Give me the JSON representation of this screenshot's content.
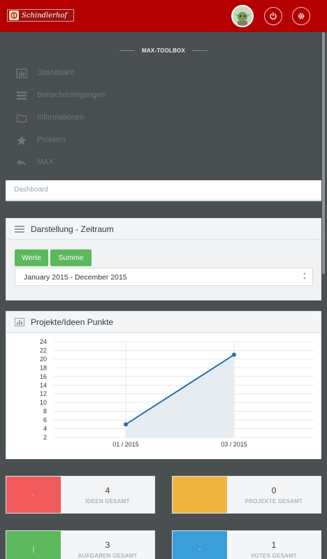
{
  "app": {
    "logo_text": "Schindlerhof",
    "avatar_alt": "user avatar",
    "icons": {
      "power": "power-icon",
      "settings": "gear-icon"
    }
  },
  "nav": {
    "title": "MAX-TOOLBOX",
    "items": [
      {
        "label": "Dashboard",
        "icon": "bar-chart-icon"
      },
      {
        "label": "Benachrichtigungen",
        "icon": "list-icon"
      },
      {
        "label": "Informationen",
        "icon": "folder-icon"
      },
      {
        "label": "Proidem",
        "icon": "star-icon"
      },
      {
        "label": "MAX",
        "icon": "reply-icon"
      }
    ]
  },
  "breadcrumb": "Dashboard",
  "timeframe_panel": {
    "title": "Darstellung - Zeitraum",
    "btn_values": "Werte",
    "btn_sum": "Summe",
    "range": "January 2015 - December 2015"
  },
  "chart_panel": {
    "title": "Projekte/Ideen Punkte"
  },
  "chart_data": {
    "type": "area",
    "categories": [
      "01 / 2015",
      "03 / 2015"
    ],
    "series": [
      {
        "values": [
          5,
          21
        ]
      }
    ],
    "yticks": [
      2,
      4,
      6,
      8,
      10,
      12,
      14,
      16,
      18,
      20,
      22,
      24
    ],
    "ylim": [
      2,
      24
    ],
    "grid": true,
    "line_color": "#2a6fa8",
    "fill_color": "#e6ecf2"
  },
  "stats": [
    {
      "value": "4",
      "label": "IDEEN GESAMT",
      "color": "#f05a5b",
      "mark": "-"
    },
    {
      "value": "0",
      "label": "PROJEKTE GESAMT",
      "color": "#f0b53f",
      "mark": ""
    },
    {
      "value": "3",
      "label": "AUFGABEN GESAMT",
      "color": "#5cb85c",
      "mark": "|"
    },
    {
      "value": "1",
      "label": "VOTES GESAMT",
      "color": "#3a9fd8",
      "mark": "-"
    }
  ],
  "colors": {
    "header": "#b40000",
    "sidebar": "#4a4f52",
    "accent_green": "#5cb85c"
  }
}
